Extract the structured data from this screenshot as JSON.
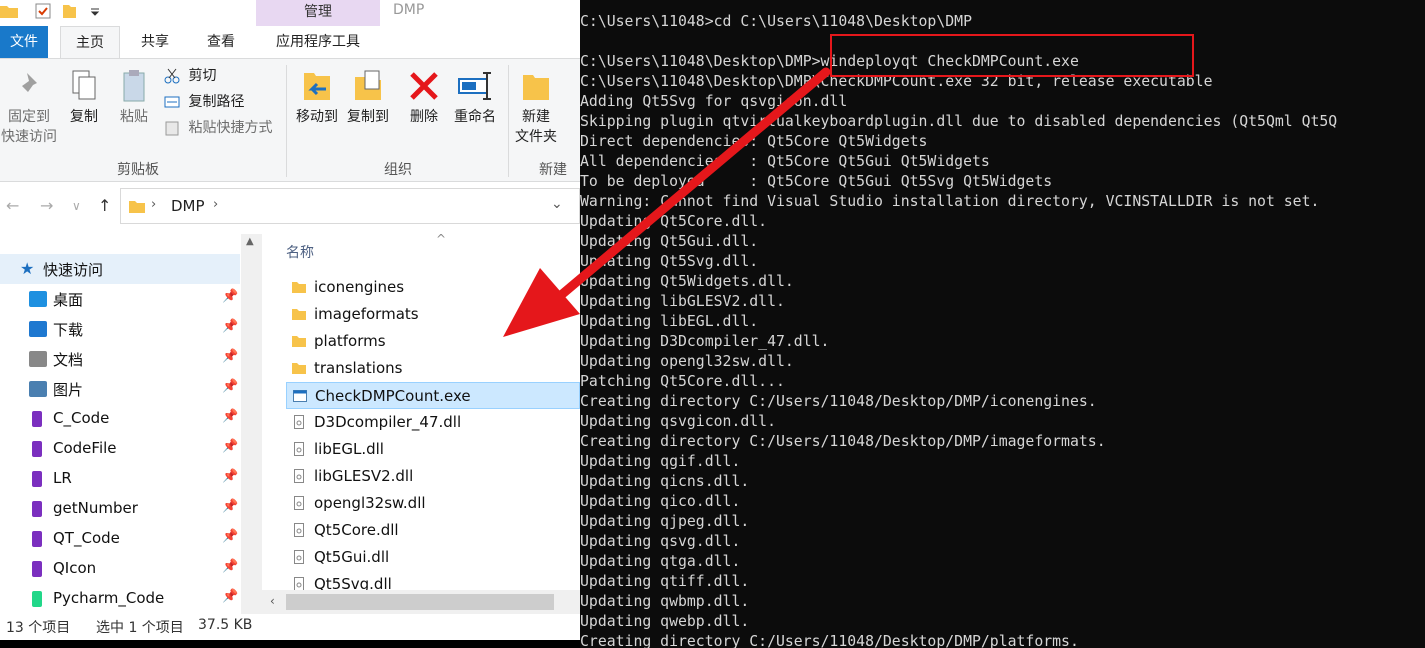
{
  "ribbon_tabs": {
    "file": "文件",
    "home": "主页",
    "share": "共享",
    "view": "查看",
    "app_tools": "应用程序工具",
    "manage": "管理",
    "window_title": "DMP"
  },
  "ribbon": {
    "pin_quick_access": "固定到\n快速访问",
    "copy": "复制",
    "paste": "粘贴",
    "cut": "剪切",
    "copy_path": "复制路径",
    "paste_shortcut": "粘贴快捷方式",
    "clipboard_group": "剪贴板",
    "move_to": "移动到",
    "copy_to": "复制到",
    "delete": "删除",
    "rename": "重命名",
    "organize_group": "组织",
    "new_folder": "新建\n文件夹",
    "new_group": "新建"
  },
  "address": {
    "path": "DMP"
  },
  "navigation": {
    "quick_access": "快速访问",
    "items": [
      {
        "label": "桌面",
        "icon": "desktop-icon",
        "color": "#1e90e0"
      },
      {
        "label": "下载",
        "icon": "download-icon",
        "color": "#1e78d0"
      },
      {
        "label": "文档",
        "icon": "document-icon",
        "color": "#888888"
      },
      {
        "label": "图片",
        "icon": "pictures-icon",
        "color": "#4a7fb0"
      },
      {
        "label": "C_Code",
        "icon": "onenote-icon",
        "color": "#7b2fbf"
      },
      {
        "label": "CodeFile",
        "icon": "onenote-icon",
        "color": "#7b2fbf"
      },
      {
        "label": "LR",
        "icon": "onenote-icon",
        "color": "#7b2fbf"
      },
      {
        "label": "getNumber",
        "icon": "onenote-icon",
        "color": "#7b2fbf"
      },
      {
        "label": "QT_Code",
        "icon": "onenote-icon",
        "color": "#7b2fbf"
      },
      {
        "label": "QIcon",
        "icon": "onenote-icon",
        "color": "#7b2fbf"
      },
      {
        "label": "Pycharm_Code",
        "icon": "pycharm-icon",
        "color": "#21d789"
      }
    ]
  },
  "file_list": {
    "column_name": "名称",
    "files": [
      {
        "name": "iconengines",
        "type": "folder"
      },
      {
        "name": "imageformats",
        "type": "folder"
      },
      {
        "name": "platforms",
        "type": "folder"
      },
      {
        "name": "translations",
        "type": "folder"
      },
      {
        "name": "CheckDMPCount.exe",
        "type": "exe",
        "selected": true
      },
      {
        "name": "D3Dcompiler_47.dll",
        "type": "dll"
      },
      {
        "name": "libEGL.dll",
        "type": "dll"
      },
      {
        "name": "libGLESV2.dll",
        "type": "dll"
      },
      {
        "name": "opengl32sw.dll",
        "type": "dll"
      },
      {
        "name": "Qt5Core.dll",
        "type": "dll"
      },
      {
        "name": "Qt5Gui.dll",
        "type": "dll"
      },
      {
        "name": "Qt5Svg.dll",
        "type": "dll"
      }
    ]
  },
  "status": {
    "count": "13 个项目",
    "selected": "选中 1 个项目",
    "size": "37.5 KB"
  },
  "console": {
    "lines": [
      "C:\\Users\\11048>cd C:\\Users\\11048\\Desktop\\DMP",
      "",
      "C:\\Users\\11048\\Desktop\\DMP>windeployqt CheckDMPCount.exe",
      "C:\\Users\\11048\\Desktop\\DMP\\CheckDMPCount.exe 32 bit, release executable",
      "Adding Qt5Svg for qsvgicon.dll",
      "Skipping plugin qtvirtualkeyboardplugin.dll due to disabled dependencies (Qt5Qml Qt5Q",
      "Direct dependencies: Qt5Core Qt5Widgets",
      "All dependencies   : Qt5Core Qt5Gui Qt5Widgets",
      "To be deployed     : Qt5Core Qt5Gui Qt5Svg Qt5Widgets",
      "Warning: Cannot find Visual Studio installation directory, VCINSTALLDIR is not set.",
      "Updating Qt5Core.dll.",
      "Updating Qt5Gui.dll.",
      "Updating Qt5Svg.dll.",
      "Updating Qt5Widgets.dll.",
      "Updating libGLESV2.dll.",
      "Updating libEGL.dll.",
      "Updating D3Dcompiler_47.dll.",
      "Updating opengl32sw.dll.",
      "Patching Qt5Core.dll...",
      "Creating directory C:/Users/11048/Desktop/DMP/iconengines.",
      "Updating qsvgicon.dll.",
      "Creating directory C:/Users/11048/Desktop/DMP/imageformats.",
      "Updating qgif.dll.",
      "Updating qicns.dll.",
      "Updating qico.dll.",
      "Updating qjpeg.dll.",
      "Updating qsvg.dll.",
      "Updating qtga.dll.",
      "Updating qtiff.dll.",
      "Updating qwbmp.dll.",
      "Updating qwebp.dll.",
      "Creating directory C:/Users/11048/Desktop/DMP/platforms."
    ]
  },
  "colors": {
    "annotation_red": "#e5171b",
    "accent_blue": "#1979ca",
    "selection": "#cce8ff",
    "folder": "#f7c34a"
  }
}
